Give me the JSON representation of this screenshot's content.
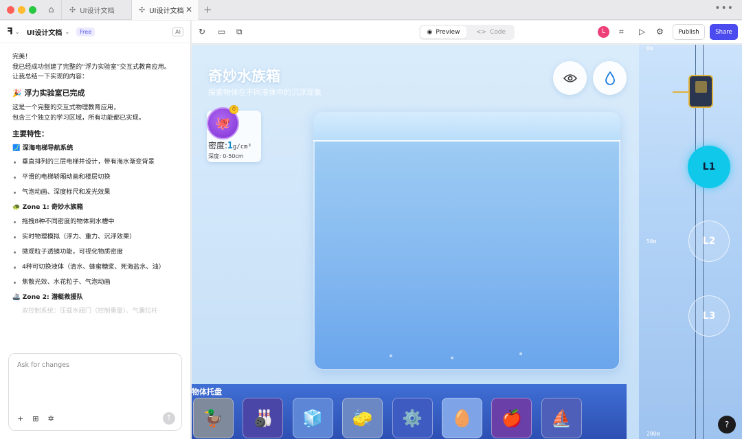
{
  "tabs": [
    {
      "label": "UI设计文档"
    },
    {
      "label": "UI设计文档"
    }
  ],
  "sidebar": {
    "doc_title": "UI设计文档",
    "plan_badge": "Free",
    "ai_badge": "AI"
  },
  "chat": {
    "line1": "完美！",
    "line2": "我已经成功创建了完整的“浮力实验室”交互式教育应用。",
    "line3": "让我总结一下实现的内容：",
    "heading": "🎉 浮力实验室已完成",
    "intro1": "这是一个完整的交互式物理教育应用，",
    "intro2": "包含三个独立的学习区域，所有功能都已实现。",
    "features_heading": "主要特性：",
    "nav_heading": "🗾 深海电梯导航系统",
    "nav_items": [
      "垂直排列的三层电梯井设计，带有海水渐变背景",
      "平滑的电梯轿厢动画和楼层切换",
      "气泡动画、深度标尺和发光效果"
    ],
    "zone1_heading": "🐢 Zone 1: 奇妙水族箱",
    "zone1_items": [
      "拖拽8种不同密度的物体到水槽中",
      "实时物理模拟（浮力、重力、沉浮效果）",
      "微观粒子透镜功能，可视化物质密度",
      "4种可切换液体（清水、蜂蜜糖浆、死海盐水、油）",
      "焦散光效、水花粒子、气泡动画"
    ],
    "zone2_heading": "🚢 Zone 2: 潜艇救援队",
    "zone2_fade": "双控制系统：压载水阀门（控制重量）、气囊拉杆"
  },
  "composer": {
    "placeholder": "Ask for changes"
  },
  "toolbar": {
    "preview_label": "Preview",
    "code_label": "Code",
    "avatar_letter": "L",
    "publish_label": "Publish",
    "share_label": "Share"
  },
  "app": {
    "title": "奇妙水族箱",
    "subtitle": "探索物体在不同液体中的沉浮现象",
    "card": {
      "density_label": "密度:",
      "density_value": "1",
      "density_unit": "g/cm³",
      "depth": "深度: 0-50cm"
    },
    "tray_label": "物体托盘",
    "tray_items": [
      {
        "icon": "duck-icon",
        "glyph": "🦆",
        "color": "#7f8a9c"
      },
      {
        "icon": "bowling-icon",
        "glyph": "🎳",
        "color": "#4a46a8"
      },
      {
        "icon": "ice-cube-icon",
        "glyph": "🧊",
        "color": "#5d86d6"
      },
      {
        "icon": "sponge-icon",
        "glyph": "🧽",
        "color": "#6b87c4"
      },
      {
        "icon": "gear-icon",
        "glyph": "⚙️",
        "color": "#3e5bc2"
      },
      {
        "icon": "egg-icon",
        "glyph": "🥚",
        "color": "#7ea3e6"
      },
      {
        "icon": "apple-icon",
        "glyph": "🍎",
        "color": "#6a3fa8"
      },
      {
        "icon": "boat-icon",
        "glyph": "⛵",
        "color": "#4d5fb8"
      }
    ],
    "depth_marks": [
      "0m",
      "50m",
      "200m"
    ],
    "floors": [
      "L1",
      "L2",
      "L3"
    ],
    "active_floor": "L1",
    "help": "?",
    "colors": {
      "accent": "#4b4bf0",
      "active_floor": "#10c8ea",
      "tray": "#3f6fd4"
    }
  }
}
